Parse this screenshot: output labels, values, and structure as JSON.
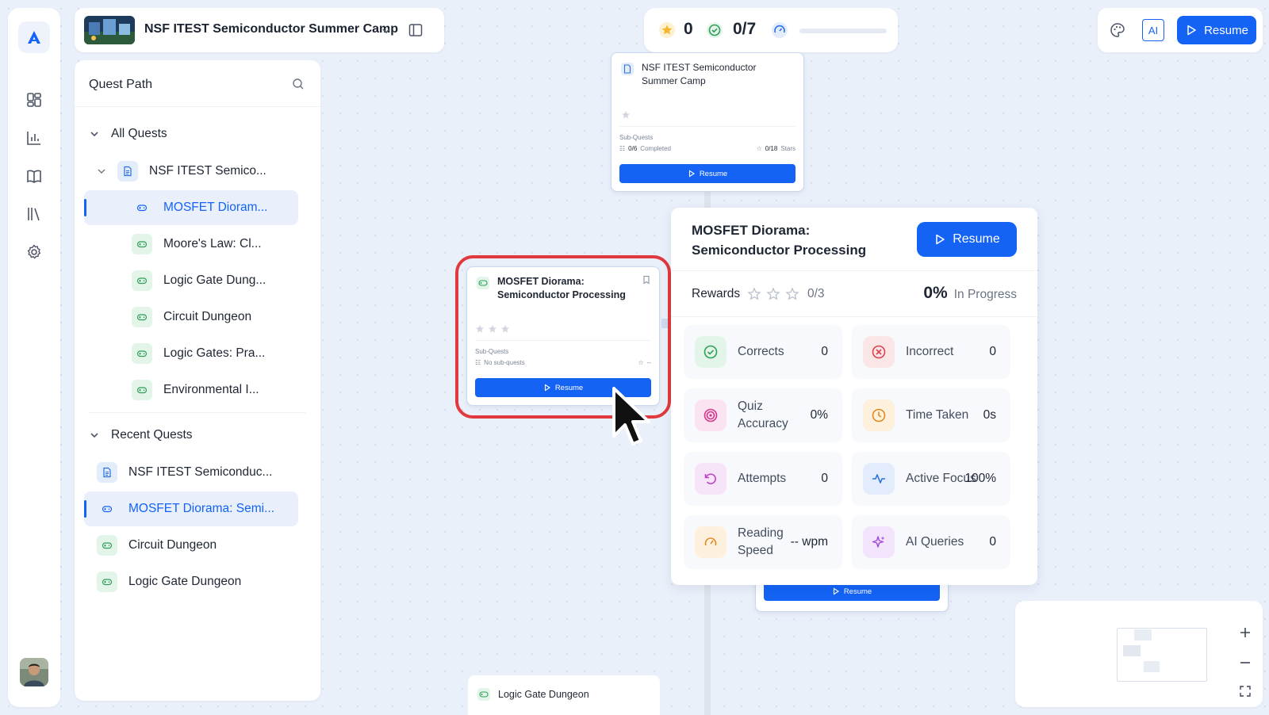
{
  "header": {
    "title": "NSF ITEST Semiconductor Summer Camp"
  },
  "stats": {
    "stars": "0",
    "completed": "0/7",
    "progress": 0
  },
  "toolbar": {
    "ai_label": "AI",
    "resume_label": "Resume"
  },
  "sidebar": {
    "title": "Quest Path",
    "all_quests_label": "All Quests",
    "parent_item": "NSF ITEST Semico...",
    "quests": [
      {
        "label": "MOSFET Dioram...",
        "active": true
      },
      {
        "label": "Moore's Law: Cl...",
        "active": false
      },
      {
        "label": "Logic Gate Dung...",
        "active": false
      },
      {
        "label": "Circuit Dungeon",
        "active": false
      },
      {
        "label": "Logic Gates: Pra...",
        "active": false
      },
      {
        "label": "Environmental I...",
        "active": false
      }
    ],
    "recent_label": "Recent Quests",
    "recent": [
      {
        "label": "NSF ITEST Semiconduc...",
        "icon": "document-icon"
      },
      {
        "label": "MOSFET Diorama: Semi...",
        "icon": "gamepad-icon",
        "active": true
      },
      {
        "label": "Circuit Dungeon",
        "icon": "gamepad-icon"
      },
      {
        "label": "Logic Gate Dungeon",
        "icon": "gamepad-icon"
      }
    ]
  },
  "canvas": {
    "root_node": {
      "title": "NSF ITEST Semiconductor Summer Camp",
      "subquests_label": "Sub-Quests",
      "completed": "0/6",
      "completed_suffix": "Completed",
      "stars": "0/18",
      "stars_suffix": "Stars",
      "button": "Resume"
    },
    "selected_node": {
      "title": "MOSFET Diorama: Semiconductor Processing",
      "subquests_label": "Sub-Quests",
      "no_subquests": "No sub-quests",
      "stars_value": "--",
      "button": "Resume"
    },
    "lower_node": {
      "button": "Resume"
    },
    "bottom_node": {
      "title": "Logic Gate Dungeon"
    }
  },
  "details": {
    "title": "MOSFET Diorama: Semiconductor Processing",
    "resume_label": "Resume",
    "rewards_label": "Rewards",
    "rewards_value": "0/3",
    "percent": "0%",
    "status": "In Progress",
    "tiles": [
      {
        "label": "Corrects",
        "value": "0",
        "icon": "check-circle-icon",
        "color": "#2f9e58",
        "bg": "#e3f5e9"
      },
      {
        "label": "Incorrect",
        "value": "0",
        "icon": "x-circle-icon",
        "color": "#d9444b",
        "bg": "#fbe6e7"
      },
      {
        "label": "Quiz Accuracy",
        "value": "0%",
        "icon": "target-icon",
        "color": "#d6338f",
        "bg": "#fbe3f1"
      },
      {
        "label": "Time Taken",
        "value": "0s",
        "icon": "clock-icon",
        "color": "#e08a1e",
        "bg": "#fdf0dd"
      },
      {
        "label": "Attempts",
        "value": "0",
        "icon": "retry-icon",
        "color": "#c042c8",
        "bg": "#f6e4f8"
      },
      {
        "label": "Active Focus",
        "value": "100%",
        "icon": "pulse-icon",
        "color": "#2a72e0",
        "bg": "#e3ecfb"
      },
      {
        "label": "Reading Speed",
        "value": "-- wpm",
        "icon": "gauge-icon",
        "color": "#e08a1e",
        "bg": "#fdf0dd"
      },
      {
        "label": "AI Queries",
        "value": "0",
        "icon": "sparkles-icon",
        "color": "#a34ad6",
        "bg": "#f1e4fb"
      }
    ]
  }
}
